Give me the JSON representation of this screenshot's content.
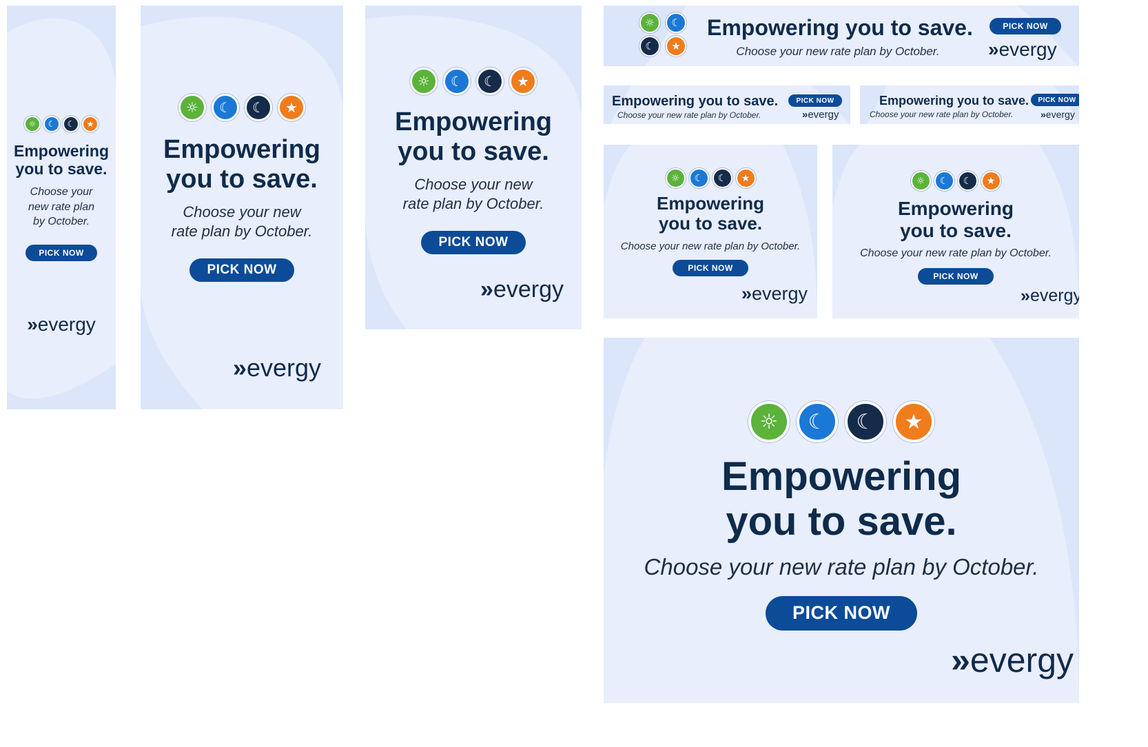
{
  "headline": "Empowering you to save.",
  "headline_line1": "Empowering",
  "headline_line2": "you to save.",
  "subline": "Choose your new rate plan by October.",
  "sub_a1": "Choose your",
  "sub_a2": "new rate plan",
  "sub_a3": "by October.",
  "sub_b1": "Choose your new",
  "sub_b2": "rate plan by October.",
  "cta": "PICK NOW",
  "brand": "evergy",
  "brand_mark": "»",
  "icons": [
    "sun-plan-icon",
    "moon-plan-icon",
    "night-plan-icon",
    "star-plan-icon"
  ],
  "colors": {
    "navy": "#0f2b4c",
    "button": "#0c4b98",
    "background": "#dfe9fb",
    "green": "#5bb33a",
    "blue": "#1b78d6",
    "dark": "#152b4a",
    "orange": "#f07c1c"
  }
}
